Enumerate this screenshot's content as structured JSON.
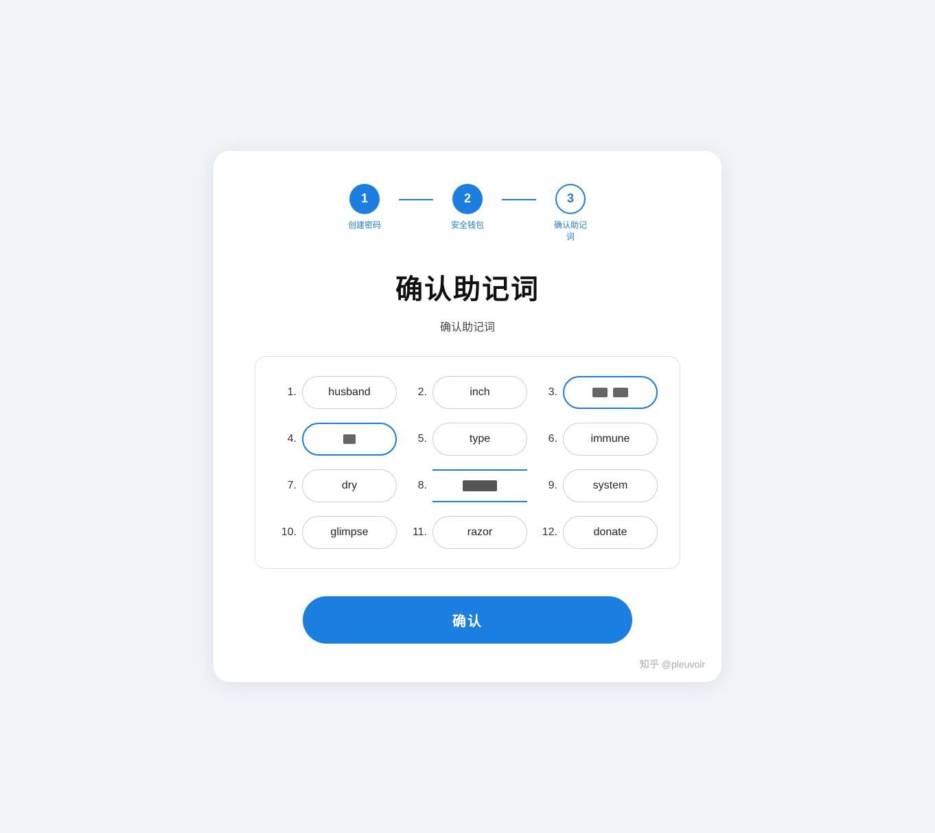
{
  "stepper": {
    "steps": [
      {
        "number": "1",
        "label": "创建密码",
        "type": "active"
      },
      {
        "number": "2",
        "label": "安全钱包",
        "type": "active"
      },
      {
        "number": "3",
        "label": "确认助记\n词",
        "type": "outline"
      }
    ]
  },
  "main_title": "确认助记词",
  "sub_title": "确认助记词",
  "words": [
    {
      "number": "1.",
      "text": "husband",
      "style": "normal"
    },
    {
      "number": "2.",
      "text": "inch",
      "style": "normal"
    },
    {
      "number": "3.",
      "text": "REDACTED_3",
      "style": "highlighted-redacted"
    },
    {
      "number": "4.",
      "text": "REDACTED_4",
      "style": "highlighted-redacted"
    },
    {
      "number": "5.",
      "text": "type",
      "style": "normal"
    },
    {
      "number": "6.",
      "text": "immune",
      "style": "normal"
    },
    {
      "number": "7.",
      "text": "dry",
      "style": "normal"
    },
    {
      "number": "8.",
      "text": "REDACTED_8",
      "style": "redacted-blue-border"
    },
    {
      "number": "9.",
      "text": "system",
      "style": "normal"
    },
    {
      "number": "10.",
      "text": "glimpse",
      "style": "normal"
    },
    {
      "number": "11.",
      "text": "razor",
      "style": "normal"
    },
    {
      "number": "12.",
      "text": "donate",
      "style": "normal"
    }
  ],
  "confirm_button": "确认",
  "watermark": "知乎 @pleuvoir"
}
